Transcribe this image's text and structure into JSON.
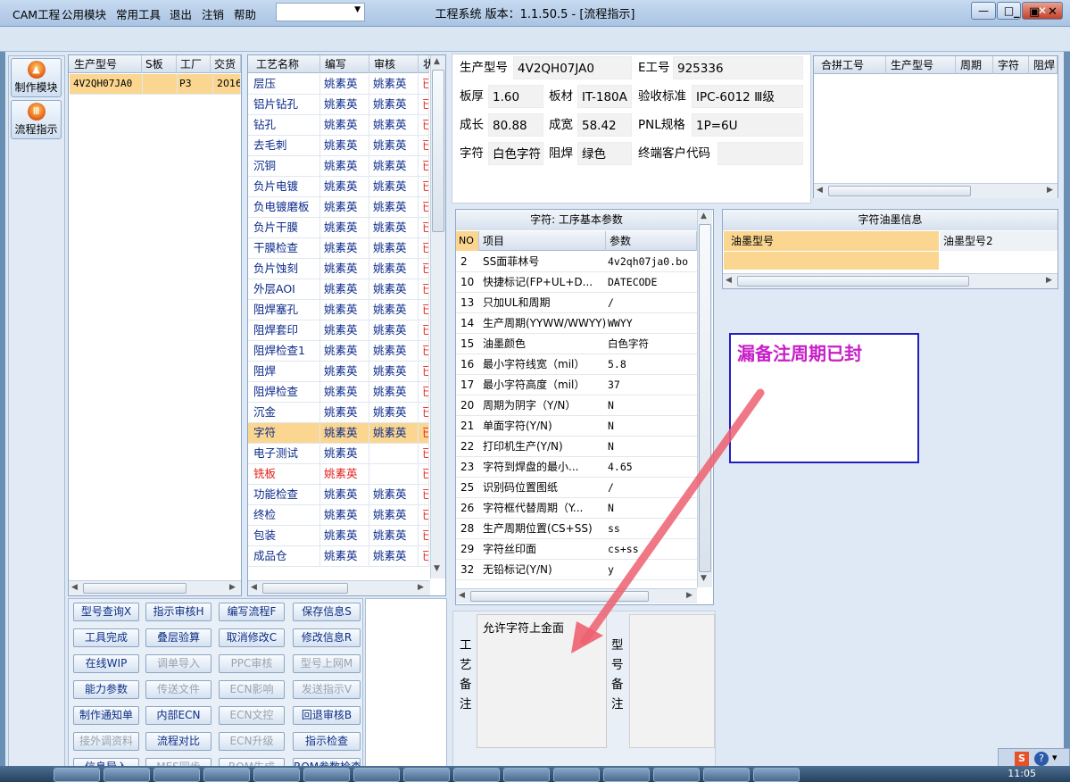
{
  "window": {
    "title": "工程系统  版本：1.1.50.5 - [流程指示]",
    "min": "—",
    "max": "□",
    "close": "✕"
  },
  "menu": {
    "items": [
      "CAM工程",
      "公用模块",
      "常用工具",
      "退出",
      "注销",
      "帮助"
    ],
    "combo": "",
    "mdi": [
      "_",
      "▣",
      "✕"
    ]
  },
  "nav": [
    {
      "label": "制作模块",
      "icon": "fire-icon"
    },
    {
      "label": "流程指示",
      "icon": "flow-icon"
    }
  ],
  "jobs": {
    "headers": [
      "生产型号",
      "S板",
      "工厂",
      "交货"
    ],
    "rows": [
      [
        "4V2QH07JA0",
        "",
        "P3",
        "2016"
      ]
    ]
  },
  "process": {
    "headers": [
      "工艺名称",
      "编写",
      "审核",
      "状"
    ],
    "rows": [
      [
        "层压",
        "姚素英",
        "姚素英",
        "已"
      ],
      [
        "铝片钻孔",
        "姚素英",
        "姚素英",
        "已"
      ],
      [
        "钻孔",
        "姚素英",
        "姚素英",
        "已"
      ],
      [
        "去毛刺",
        "姚素英",
        "姚素英",
        "已"
      ],
      [
        "沉铜",
        "姚素英",
        "姚素英",
        "已"
      ],
      [
        "负片电镀",
        "姚素英",
        "姚素英",
        "已"
      ],
      [
        "负电镀磨板",
        "姚素英",
        "姚素英",
        "已"
      ],
      [
        "负片干膜",
        "姚素英",
        "姚素英",
        "已"
      ],
      [
        "干膜检查",
        "姚素英",
        "姚素英",
        "已"
      ],
      [
        "负片蚀刻",
        "姚素英",
        "姚素英",
        "已"
      ],
      [
        "外层AOI",
        "姚素英",
        "姚素英",
        "已"
      ],
      [
        "阻焊塞孔",
        "姚素英",
        "姚素英",
        "已"
      ],
      [
        "阻焊套印",
        "姚素英",
        "姚素英",
        "已"
      ],
      [
        "阻焊检查1",
        "姚素英",
        "姚素英",
        "已"
      ],
      [
        "阻焊",
        "姚素英",
        "姚素英",
        "已"
      ],
      [
        "阻焊检查",
        "姚素英",
        "姚素英",
        "已"
      ],
      [
        "沉金",
        "姚素英",
        "姚素英",
        "已"
      ],
      [
        "字符",
        "姚素英",
        "姚素英",
        "已"
      ],
      [
        "电子测试",
        "姚素英",
        "",
        "已"
      ],
      [
        "铣板",
        "姚素英",
        "",
        "已"
      ],
      [
        "功能检查",
        "姚素英",
        "姚素英",
        "已"
      ],
      [
        "终检",
        "姚素英",
        "姚素英",
        "已"
      ],
      [
        "包装",
        "姚素英",
        "姚素英",
        "已"
      ],
      [
        "成品仓",
        "姚素英",
        "姚素英",
        "已"
      ]
    ],
    "selected": 17,
    "red": 19
  },
  "buttons": [
    [
      "型号查询X",
      "指示审核H",
      "编写流程F",
      "保存信息S"
    ],
    [
      "工具完成",
      "叠层验算",
      "取消修改C",
      "修改信息R"
    ],
    [
      "在线WIP",
      "调单导入",
      "PPC审核",
      "型号上网M"
    ],
    [
      "能力参数",
      "传送文件",
      "ECN影响",
      "发送指示V"
    ],
    [
      "制作通知单",
      "内部ECN",
      "ECN文控",
      "回退审核B"
    ],
    [
      "接外调资料",
      "流程对比",
      "ECN升级",
      "指示检查"
    ],
    [
      "信息导入",
      "MES同步",
      "ROM生成",
      "ROM参数检查"
    ]
  ],
  "btn_disabled": [
    [
      0,
      0,
      0,
      0
    ],
    [
      0,
      0,
      0,
      0
    ],
    [
      0,
      1,
      1,
      1
    ],
    [
      0,
      1,
      1,
      1
    ],
    [
      0,
      0,
      1,
      0
    ],
    [
      1,
      0,
      1,
      0
    ],
    [
      0,
      1,
      1,
      0
    ]
  ],
  "info": {
    "model_label": "生产型号",
    "model": "4V2QH07JA0",
    "e_label": "E工号",
    "e": "925336",
    "thick_label": "板厚",
    "thick": "1.60",
    "mat_label": "板材",
    "mat": "IT-180A",
    "std_label": "验收标准",
    "std": "IPC-6012 Ⅲ级",
    "len_label": "成长",
    "len": "80.88",
    "wid_label": "成宽",
    "wid": "58.42",
    "pnl_label": "PNL规格",
    "pnl": "1P=6U",
    "char_label": "字符",
    "char": "白色字符",
    "mask_label": "阻焊",
    "mask": "绿色",
    "cust_label": "终端客户代码",
    "cust": ""
  },
  "combine": {
    "headers": [
      "合拼工号",
      "生产型号",
      "周期",
      "字符",
      "阻焊"
    ]
  },
  "params": {
    "title": "字符: 工序基本参数",
    "headers": [
      "NO",
      "项目",
      "参数"
    ],
    "rows": [
      [
        "2",
        "SS面菲林号",
        "4v2qh07ja0.bo"
      ],
      [
        "10",
        "快捷标记(FP+UL+D...",
        "DATECODE"
      ],
      [
        "13",
        "只加UL和周期",
        "/"
      ],
      [
        "14",
        "生产周期(YYWW/WWYY)",
        "WWYY"
      ],
      [
        "15",
        "油墨颜色",
        "白色字符"
      ],
      [
        "16",
        "最小字符线宽（mil）",
        "5.8"
      ],
      [
        "17",
        "最小字符高度（mil）",
        "37"
      ],
      [
        "20",
        "周期为阴字（Y/N）",
        "N"
      ],
      [
        "21",
        "单面字符(Y/N)",
        "N"
      ],
      [
        "22",
        "打印机生产(Y/N)",
        "N"
      ],
      [
        "23",
        "字符到焊盘的最小...",
        "4.65"
      ],
      [
        "25",
        "识别码位置图纸",
        "/"
      ],
      [
        "26",
        "字符框代替周期（Y...",
        "N"
      ],
      [
        "28",
        "生产周期位置(CS+SS)",
        "ss"
      ],
      [
        "29",
        "字符丝印面",
        "cs+ss"
      ],
      [
        "32",
        "无铅标记(Y/N)",
        "y"
      ]
    ]
  },
  "ink": {
    "title": "字符油墨信息",
    "headers": [
      "油墨型号",
      "油墨型号2"
    ]
  },
  "remarks": {
    "process_label": "工艺备注",
    "process_text": "允许字符上金面",
    "model_label": "型号备注"
  },
  "annotation": "漏备注周期已封",
  "clock": "11:05",
  "colors": {
    "accent": "#fbd690",
    "annotation": "#c81ec8",
    "arrow": "#ee6070"
  }
}
